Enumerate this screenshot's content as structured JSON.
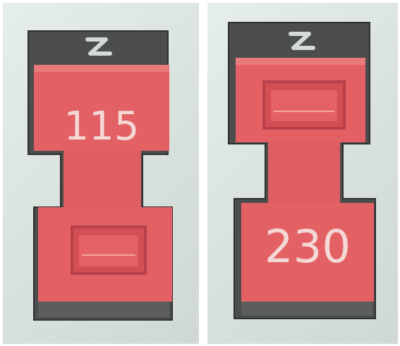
{
  "switches": [
    {
      "position": "left",
      "value_label": "115",
      "active_side": "top"
    },
    {
      "position": "right",
      "value_label": "230",
      "active_side": "bottom"
    }
  ],
  "colors": {
    "background": "#dfe8e3",
    "housing": "#4a4d4b",
    "slider": "#e06062",
    "slider_dark": "#c94c50",
    "label_text": "#f3d8d6"
  }
}
